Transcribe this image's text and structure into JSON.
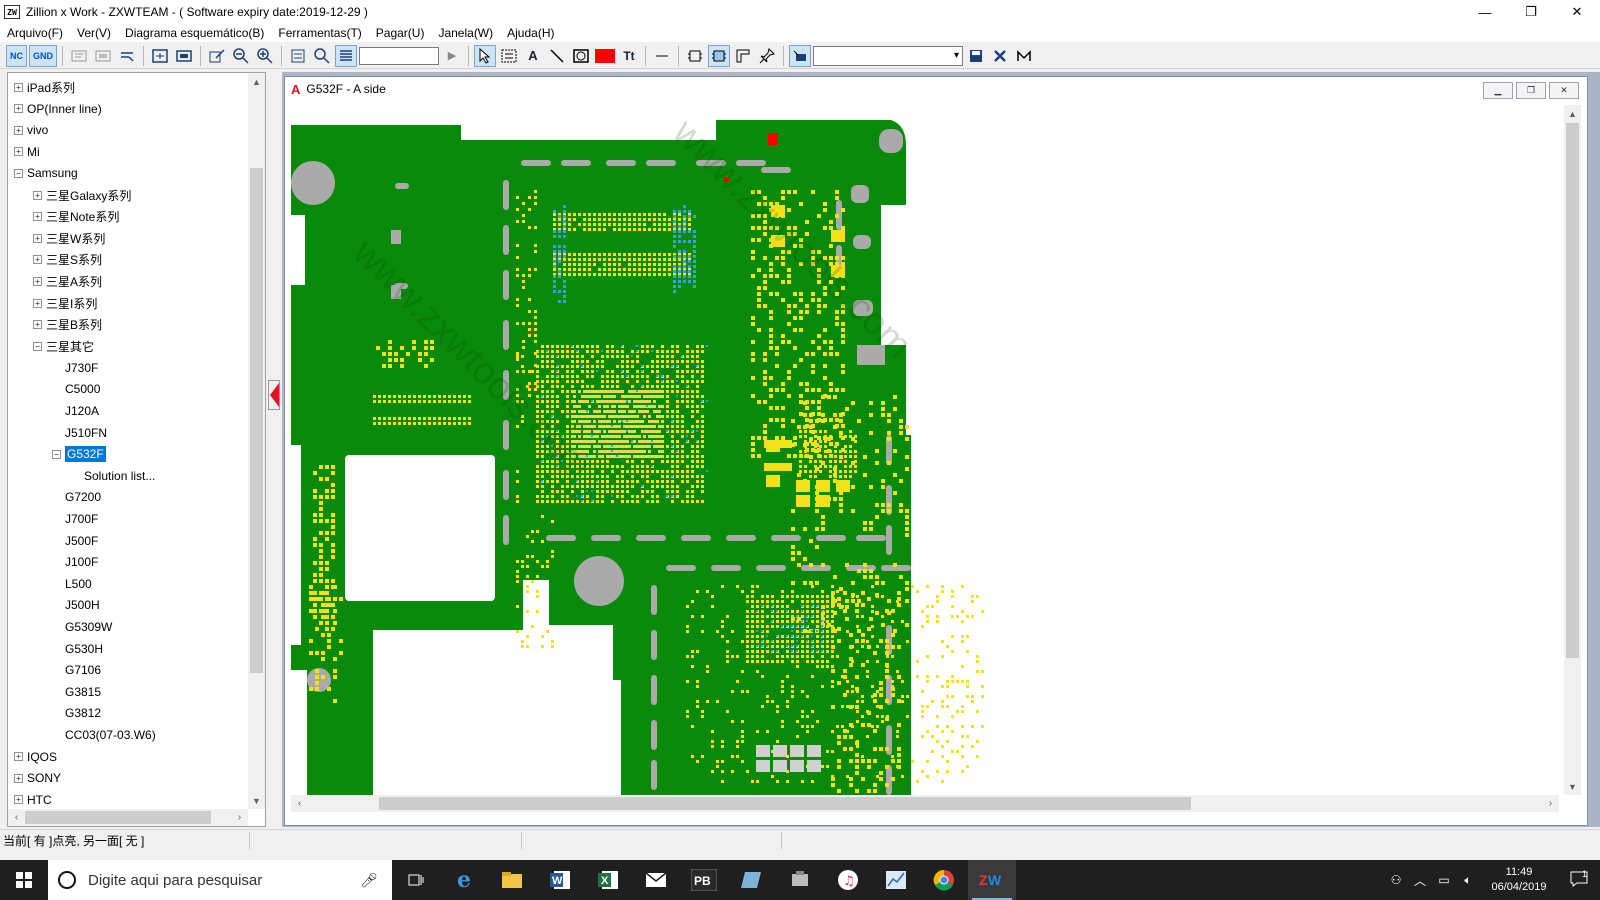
{
  "window": {
    "app_icon": "ZW",
    "title": "Zillion x Work - ZXWTEAM - ( Software expiry date:2019-12-29 )",
    "minimize": "—",
    "maximize": "❐",
    "close": "✕"
  },
  "menu": [
    "Arquivo(F)",
    "Ver(V)",
    "Diagrama esquemático(B)",
    "Ferramentas(T)",
    "Pagar(U)",
    "Janela(W)",
    "Ajuda(H)"
  ],
  "toolbar": {
    "nc_label": "NC",
    "gnd_label": "GND",
    "text_tool": "A",
    "text_size_tool": "Tt",
    "search_value": "",
    "layer_combo_value": ""
  },
  "tree": [
    {
      "label": "iPad系列",
      "indent": 0,
      "expander": "+"
    },
    {
      "label": "OP(Inner line)",
      "indent": 0,
      "expander": "+"
    },
    {
      "label": "vivo",
      "indent": 0,
      "expander": "+"
    },
    {
      "label": "Mi",
      "indent": 0,
      "expander": "+"
    },
    {
      "label": "Samsung",
      "indent": 0,
      "expander": "−"
    },
    {
      "label": "三星Galaxy系列",
      "indent": 1,
      "expander": "+"
    },
    {
      "label": "三星Note系列",
      "indent": 1,
      "expander": "+"
    },
    {
      "label": "三星W系列",
      "indent": 1,
      "expander": "+"
    },
    {
      "label": "三星S系列",
      "indent": 1,
      "expander": "+"
    },
    {
      "label": "三星A系列",
      "indent": 1,
      "expander": "+"
    },
    {
      "label": "三星I系列",
      "indent": 1,
      "expander": "+"
    },
    {
      "label": "三星B系列",
      "indent": 1,
      "expander": "+"
    },
    {
      "label": "三星其它",
      "indent": 1,
      "expander": "−"
    },
    {
      "label": "J730F",
      "indent": 2,
      "expander": ""
    },
    {
      "label": "C5000",
      "indent": 2,
      "expander": ""
    },
    {
      "label": "J120A",
      "indent": 2,
      "expander": ""
    },
    {
      "label": "J510FN",
      "indent": 2,
      "expander": ""
    },
    {
      "label": "G532F",
      "indent": 2,
      "expander": "−",
      "selected": true
    },
    {
      "label": "Solution list...",
      "indent": 3,
      "expander": ""
    },
    {
      "label": "G7200",
      "indent": 2,
      "expander": ""
    },
    {
      "label": "J700F",
      "indent": 2,
      "expander": ""
    },
    {
      "label": "J500F",
      "indent": 2,
      "expander": ""
    },
    {
      "label": "J100F",
      "indent": 2,
      "expander": ""
    },
    {
      "label": "L500",
      "indent": 2,
      "expander": ""
    },
    {
      "label": "J500H",
      "indent": 2,
      "expander": ""
    },
    {
      "label": "G5309W",
      "indent": 2,
      "expander": ""
    },
    {
      "label": "G530H",
      "indent": 2,
      "expander": ""
    },
    {
      "label": "G7106",
      "indent": 2,
      "expander": ""
    },
    {
      "label": "G3815",
      "indent": 2,
      "expander": ""
    },
    {
      "label": "G3812",
      "indent": 2,
      "expander": ""
    },
    {
      "label": "CC03(07-03.W6)",
      "indent": 2,
      "expander": ""
    },
    {
      "label": "IQOS",
      "indent": 0,
      "expander": "+"
    },
    {
      "label": "SONY",
      "indent": 0,
      "expander": "+"
    },
    {
      "label": "HTC",
      "indent": 0,
      "expander": "+"
    }
  ],
  "child_window": {
    "icon": "A",
    "title": "G532F - A side"
  },
  "board": {
    "watermark": "www.zxwtools.com",
    "board_color": "#0a8a0a",
    "pad_color": "#f5e11a",
    "via_color": "#3aa0e0",
    "hole_color": "#aaaaaa",
    "highlight_color": "#ff0000"
  },
  "status": {
    "text": "当前[ 有 ]点亮, 另一面[ 无 ]"
  },
  "taskbar": {
    "search_placeholder": "Digite aqui para pesquisar",
    "apps": [
      "task-view",
      "edge",
      "file-explorer",
      "word",
      "excel",
      "mail",
      "PB",
      "app-blue",
      "app-gray",
      "itunes",
      "app-chart",
      "chrome",
      "ZW"
    ],
    "time": "11:49",
    "date": "06/04/2019",
    "notification_count": "1"
  }
}
